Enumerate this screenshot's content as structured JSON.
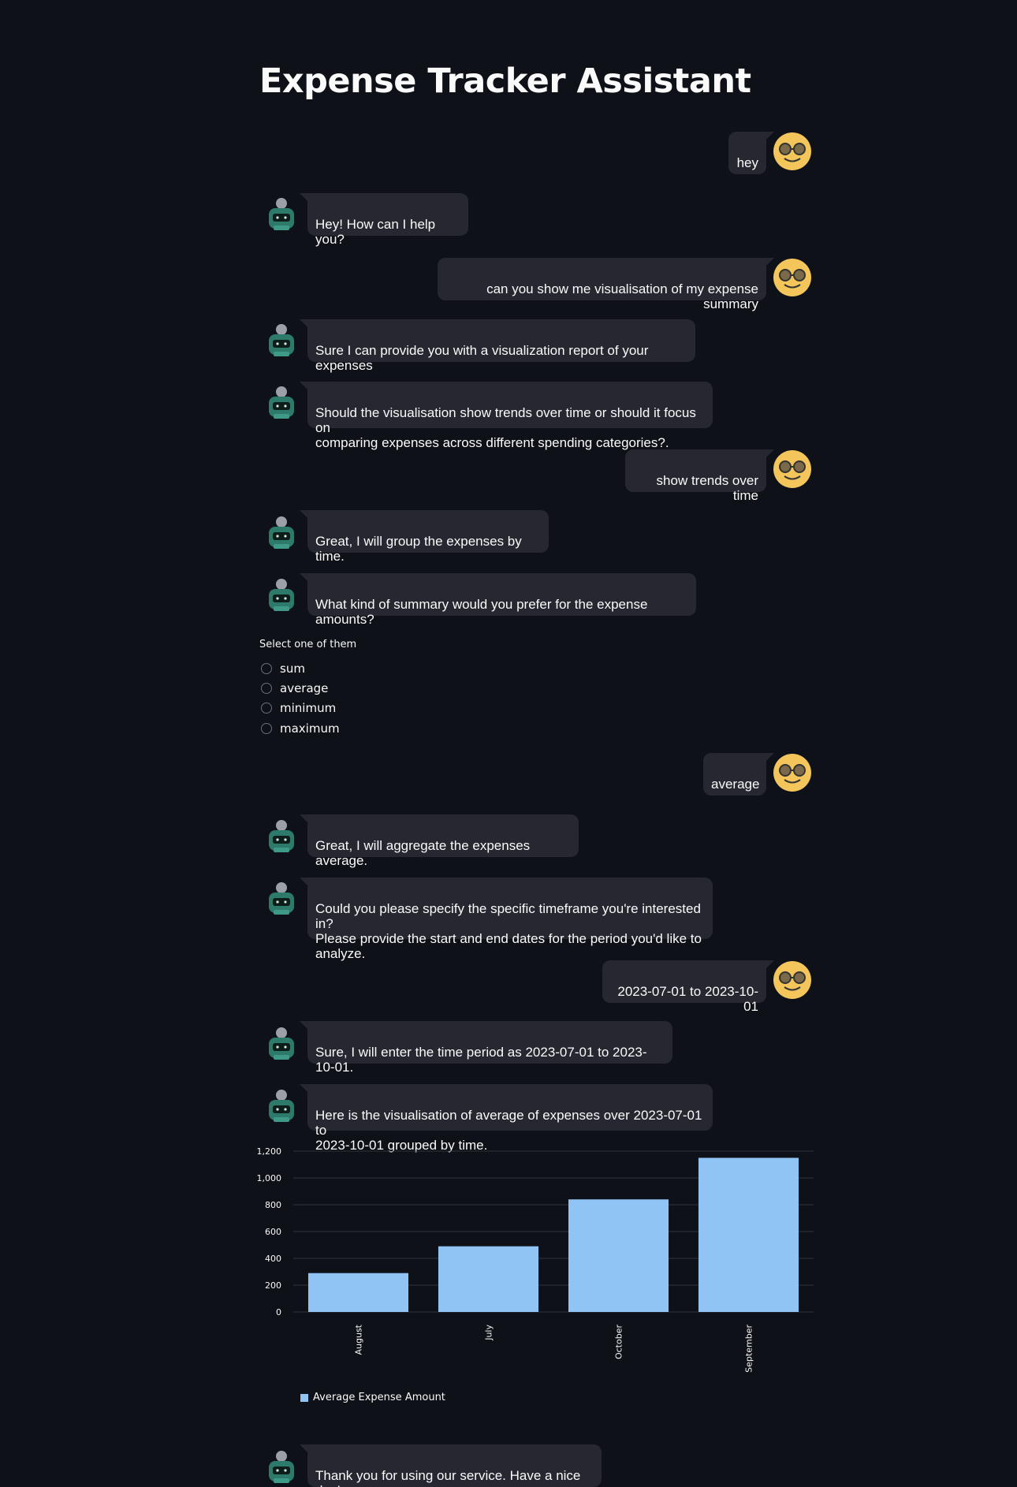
{
  "page": {
    "title": "Expense Tracker Assistant"
  },
  "messages": [
    {
      "role": "user",
      "text": "hey"
    },
    {
      "role": "assistant",
      "text": "Hey! How can I help you?"
    },
    {
      "role": "user",
      "text": "can you show me visualisation of my expense summary"
    },
    {
      "role": "assistant",
      "text": "Sure I can provide you with a visualization report of your expenses"
    },
    {
      "role": "assistant",
      "text": "Should the visualisation show trends over time or should it focus on\ncomparing expenses across different spending categories?."
    },
    {
      "role": "user",
      "text": "show trends over time"
    },
    {
      "role": "assistant",
      "text": "Great, I will group the expenses by time."
    },
    {
      "role": "assistant",
      "text": "What kind of summary would you prefer for the expense amounts?"
    },
    {
      "role": "user",
      "text": "average"
    },
    {
      "role": "assistant",
      "text": "Great, I will aggregate the expenses average."
    },
    {
      "role": "assistant",
      "text": "Could you please specify the specific timeframe you're interested in?\nPlease provide the start and end dates for the period you'd like to\nanalyze."
    },
    {
      "role": "user",
      "text": "2023-07-01 to 2023-10-01"
    },
    {
      "role": "assistant",
      "text": "Sure, I will enter the time period as 2023-07-01 to 2023-10-01."
    },
    {
      "role": "assistant",
      "text": "Here is the visualisation of average of expenses over 2023-07-01 to\n2023-10-01 grouped by time."
    },
    {
      "role": "assistant",
      "text": "Thank you for using our service. Have a nice day!"
    }
  ],
  "radio": {
    "label": "Select one of them",
    "options": [
      "sum",
      "average",
      "minimum",
      "maximum"
    ]
  },
  "chart_data": {
    "type": "bar",
    "categories": [
      "August",
      "July",
      "October",
      "September"
    ],
    "series": [
      {
        "name": "Average Expense Amount",
        "values": [
          290,
          490,
          840,
          1150
        ],
        "color": "#90c4f5"
      }
    ],
    "yticks": [
      0,
      200,
      400,
      600,
      800,
      1000,
      1200
    ],
    "ytick_labels": [
      "0",
      "200",
      "400",
      "600",
      "800",
      "1,000",
      "1,200"
    ],
    "ylim": [
      0,
      1200
    ],
    "title": "",
    "xlabel": "",
    "ylabel": "",
    "grid": true,
    "legend": "bottom-left"
  },
  "colors": {
    "background": "#0e1117",
    "bubble": "#262730",
    "text": "#fafafa"
  },
  "icons": {
    "user_avatar": "smiley-glasses-icon",
    "bot_avatar": "robot-icon"
  }
}
